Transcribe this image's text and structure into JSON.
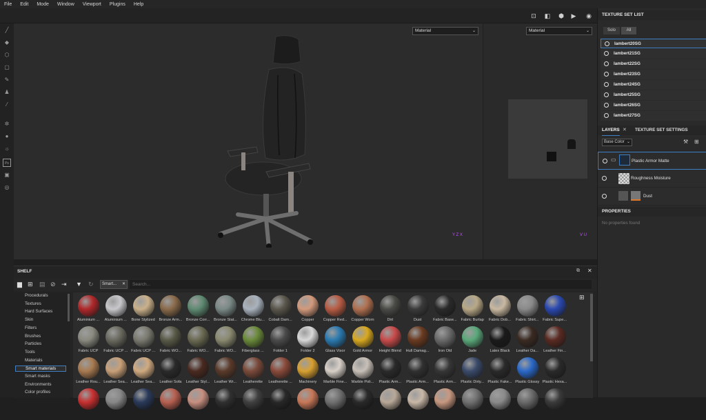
{
  "menu": [
    "File",
    "Edit",
    "Mode",
    "Window",
    "Viewport",
    "Plugins",
    "Help"
  ],
  "viewport": {
    "left_mode": "Material",
    "right_mode": "Material",
    "axis_left": "Y Z X",
    "axis_right": "V U"
  },
  "right_panel": {
    "texture_set_list_title": "TEXTURE SET LIST",
    "solo_label": "Solo",
    "all_label": "All",
    "texture_sets": [
      "lambert20SG",
      "lambert21SG",
      "lambert22SG",
      "lambert23SG",
      "lambert24SG",
      "lambert25SG",
      "lambert26SG",
      "lambert27SG"
    ],
    "layers_tab": "LAYERS",
    "texture_set_settings_tab": "TEXTURE SET SETTINGS",
    "channel": "Base Color",
    "layers": [
      "Plastic Armor Matte",
      "Roughness Moisture",
      "Dust"
    ],
    "properties_title": "PROPERTIES",
    "properties_empty": "No properties found"
  },
  "shelf": {
    "title": "SHELF",
    "filter_tag": "Smart...",
    "search_placeholder": "Search...",
    "categories": [
      "Procedurals",
      "Textures",
      "Hard Surfaces",
      "Skin",
      "Filters",
      "Brushes",
      "Particles",
      "Tools",
      "Materials",
      "Smart materials",
      "Smart masks",
      "Environments",
      "Color profiles"
    ],
    "selected_category": "Smart materials",
    "materials": [
      {
        "name": "Aluminium ...",
        "color": "#b0282a"
      },
      {
        "name": "Aluminium ...",
        "color": "#c8c8cc"
      },
      {
        "name": "Bone Stylized",
        "color": "#c9b08a"
      },
      {
        "name": "Bronze Arm...",
        "color": "#8a6a4a"
      },
      {
        "name": "Bronze Corr...",
        "color": "#5f8a72"
      },
      {
        "name": "Bronze Stat...",
        "color": "#7a8a86"
      },
      {
        "name": "Chrome Blu...",
        "color": "#a9b2bd"
      },
      {
        "name": "Cobalt Dam...",
        "color": "#5a564c"
      },
      {
        "name": "Copper",
        "color": "#d39a7c"
      },
      {
        "name": "Copper Red...",
        "color": "#b85c44"
      },
      {
        "name": "Copper Worn",
        "color": "#b07050"
      },
      {
        "name": "Dirt",
        "color": "#4a4a46"
      },
      {
        "name": "Dust",
        "color": "#3a3a3a"
      },
      {
        "name": "Fabric Base...",
        "color": "#2a2a2a"
      },
      {
        "name": "Fabric Burlap",
        "color": "#b8a886"
      },
      {
        "name": "Fabric Dob...",
        "color": "#c8b8a0"
      },
      {
        "name": "Fabric Shirt...",
        "color": "#8a8a8a"
      },
      {
        "name": "Fabric Supe...",
        "color": "#2a48b0"
      },
      {
        "name": "Fabric UCP",
        "color": "#8a8a80"
      },
      {
        "name": "Fabric UCP ...",
        "color": "#6a6a60"
      },
      {
        "name": "Fabric UCP ...",
        "color": "#7a7a70"
      },
      {
        "name": "Fabric WO...",
        "color": "#5a5a48"
      },
      {
        "name": "Fabric WO...",
        "color": "#6a6a52"
      },
      {
        "name": "Fabric WO...",
        "color": "#8a8a70"
      },
      {
        "name": "Fiberglass ...",
        "color": "#6a8a3a"
      },
      {
        "name": "Folder 1",
        "color": "#4a4a4a"
      },
      {
        "name": "Folder 2",
        "color": "#d8d8d8"
      },
      {
        "name": "Glass Visor",
        "color": "#2a7ab0"
      },
      {
        "name": "Gold Armor",
        "color": "#d8a820"
      },
      {
        "name": "Height Blend",
        "color": "#c84a4a"
      },
      {
        "name": "Hull Damag...",
        "color": "#6a3a20"
      },
      {
        "name": "Iron Old",
        "color": "#6a6a6a"
      },
      {
        "name": "Jade",
        "color": "#5aa87a"
      },
      {
        "name": "Latex Black",
        "color": "#1a1a1a"
      },
      {
        "name": "Leather Da...",
        "color": "#3a2a22"
      },
      {
        "name": "Leather Fin...",
        "color": "#5a2a22"
      },
      {
        "name": "Leather Rou...",
        "color": "#a87a50"
      },
      {
        "name": "Leather Sea...",
        "color": "#c8a078"
      },
      {
        "name": "Leather Sea...",
        "color": "#d0aa80"
      },
      {
        "name": "Leather Sofa",
        "color": "#2a2a2a"
      },
      {
        "name": "Leather Styl...",
        "color": "#4a2a20"
      },
      {
        "name": "Leather Wr...",
        "color": "#5a3a2a"
      },
      {
        "name": "Leatherette",
        "color": "#7a4a3a"
      },
      {
        "name": "Leatherette ...",
        "color": "#8a4a3a"
      },
      {
        "name": "Machinery",
        "color": "#d8a030"
      },
      {
        "name": "Marble Fine...",
        "color": "#d8d0c8"
      },
      {
        "name": "Marble Poli...",
        "color": "#c8c0b8"
      },
      {
        "name": "Plastic Arm...",
        "color": "#2a2a2a"
      },
      {
        "name": "Plastic Arm...",
        "color": "#303030"
      },
      {
        "name": "Plastic Arm...",
        "color": "#363636"
      },
      {
        "name": "Plastic Dirty...",
        "color": "#3a4a6a"
      },
      {
        "name": "Plastic Fake...",
        "color": "#2a2a2a"
      },
      {
        "name": "Plastic Glossy",
        "color": "#2a68c8"
      },
      {
        "name": "Plastic Hexa...",
        "color": "#2a2a2a"
      },
      {
        "name": "",
        "color": "#c83030"
      },
      {
        "name": "",
        "color": "#888"
      },
      {
        "name": "",
        "color": "#2a3a5a"
      },
      {
        "name": "",
        "color": "#b86050"
      },
      {
        "name": "",
        "color": "#c89080"
      },
      {
        "name": "",
        "color": "#303030"
      },
      {
        "name": "",
        "color": "#404040"
      },
      {
        "name": "",
        "color": "#282828"
      },
      {
        "name": "",
        "color": "#c87858"
      },
      {
        "name": "",
        "color": "#707070"
      },
      {
        "name": "",
        "color": "#2a2a2a"
      },
      {
        "name": "",
        "color": "#b8a898"
      },
      {
        "name": "",
        "color": "#c8b8a8"
      },
      {
        "name": "",
        "color": "#c89880"
      },
      {
        "name": "",
        "color": "#707070"
      },
      {
        "name": "",
        "color": "#8a8a8a"
      },
      {
        "name": "",
        "color": "#6a6a6a"
      },
      {
        "name": "",
        "color": "#3a3a3a"
      }
    ]
  }
}
